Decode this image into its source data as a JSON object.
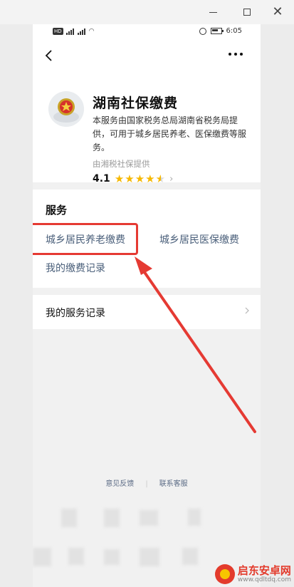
{
  "status_bar": {
    "network": "HD",
    "time": "6:05"
  },
  "app": {
    "title": "湖南社保缴费",
    "description": "本服务由国家税务总局湖南省税务局提供，可用于城乡居民养老、医保缴费等服务。",
    "provider": "由湘税社保提供",
    "rating": "4.1",
    "stars_fraction": 0.82
  },
  "services": {
    "section_title": "服务",
    "items": [
      "城乡居民养老缴费",
      "城乡居民医保缴费",
      "我的缴费记录"
    ]
  },
  "records": {
    "label": "我的服务记录"
  },
  "footer": {
    "feedback": "意见反馈",
    "support": "联系客服"
  },
  "watermark": {
    "title": "启东安卓网",
    "url": "www.qdltdq.com"
  },
  "colors": {
    "highlight": "#e53a33",
    "link": "#4a5f7a",
    "star": "#f6b800"
  }
}
